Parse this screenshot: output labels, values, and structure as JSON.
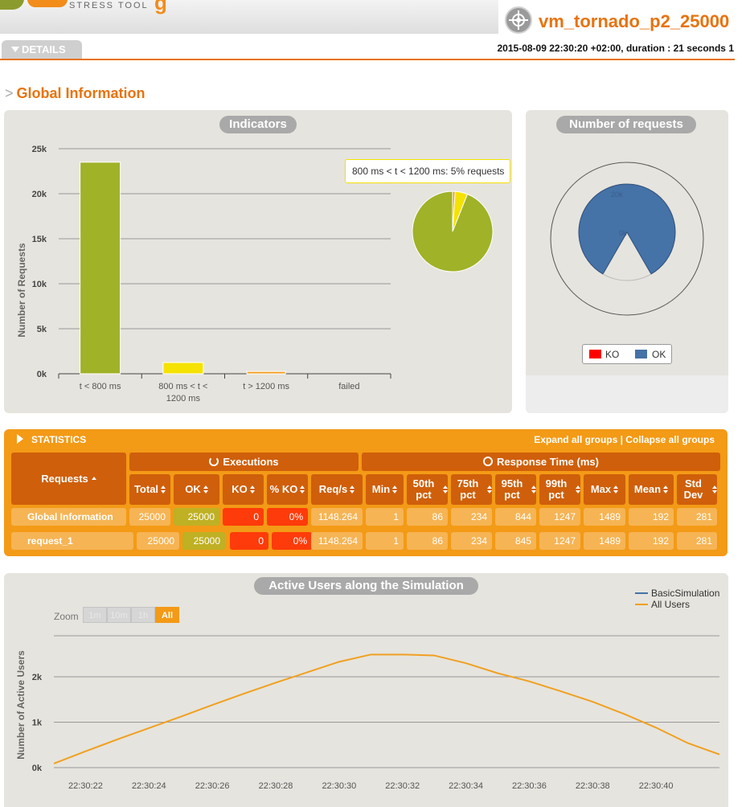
{
  "header": {
    "tagline": "STRESS TOOL",
    "simulation_name": "vm_tornado_p2_25000",
    "details_label": "DETAILS",
    "run_info": "2015-08-09 22:30:20 +02:00, duration : 21 seconds 1"
  },
  "section": {
    "prefix": ">",
    "title": "Global Information"
  },
  "indicators": {
    "title": "Indicators",
    "tooltip": "800 ms < t < 1200 ms: 5% requests",
    "chart_data": {
      "type": "bar",
      "title": "Indicators",
      "ylabel": "Number of Requests",
      "ylim": [
        0,
        25000
      ],
      "yticks": [
        "0k",
        "5k",
        "10k",
        "15k",
        "20k",
        "25k"
      ],
      "categories": [
        "t < 800 ms",
        "800 ms < t < 1200 ms",
        "t > 1200 ms",
        "failed"
      ],
      "values": [
        23500,
        1250,
        250,
        0
      ],
      "colors": [
        "#a0b228",
        "#f5e200",
        "#f39a16",
        "#fe3b0a"
      ]
    },
    "pie_data": {
      "type": "pie",
      "values": [
        94,
        5,
        1
      ],
      "colors": [
        "#a0b228",
        "#f5e200",
        "#f39a16"
      ]
    }
  },
  "requests": {
    "title": "Number of requests",
    "chart_data": {
      "type": "pie",
      "series": [
        {
          "name": "KO",
          "value": 0
        },
        {
          "name": "OK",
          "value": 25000
        }
      ],
      "ticks": [
        "0k",
        "20k"
      ],
      "colors": {
        "KO": "#ff0000",
        "OK": "#4572a7"
      }
    },
    "legend": [
      {
        "name": "KO",
        "color": "#ff0000"
      },
      {
        "name": "OK",
        "color": "#4572a7"
      }
    ]
  },
  "statistics": {
    "title": "STATISTICS",
    "links": "Expand all groups | Collapse all groups",
    "requests_header": "Requests",
    "executions_header": "Executions",
    "response_header": "Response Time (ms)",
    "columns": [
      "Total",
      "OK",
      "KO",
      "% KO",
      "Req/s",
      "Min",
      "50th pct",
      "75th pct",
      "95th pct",
      "99th pct",
      "Max",
      "Mean",
      "Std Dev"
    ],
    "rows": [
      {
        "name": "Global Information",
        "values": [
          "25000",
          "25000",
          "0",
          "0%",
          "1148.264",
          "1",
          "86",
          "234",
          "844",
          "1247",
          "1489",
          "192",
          "281"
        ]
      },
      {
        "name": "request_1",
        "values": [
          "25000",
          "25000",
          "0",
          "0%",
          "1148.264",
          "1",
          "86",
          "234",
          "845",
          "1247",
          "1489",
          "192",
          "281"
        ]
      }
    ]
  },
  "active_users": {
    "title": "Active Users along the Simulation",
    "zoom_label": "Zoom",
    "zoom_buttons": [
      "1m",
      "10m",
      "1h",
      "All"
    ],
    "chart_data": {
      "type": "line",
      "title": "Active Users along the Simulation",
      "ylabel": "Number of Active Users",
      "yticks": [
        "0k",
        "1k",
        "2k"
      ],
      "ylim": [
        0,
        2800
      ],
      "x": [
        "22:30:21",
        "22:30:22",
        "22:30:23",
        "22:30:24",
        "22:30:25",
        "22:30:26",
        "22:30:27",
        "22:30:28",
        "22:30:29",
        "22:30:30",
        "22:30:31",
        "22:30:32",
        "22:30:33",
        "22:30:34",
        "22:30:35",
        "22:30:36",
        "22:30:37",
        "22:30:38",
        "22:30:39",
        "22:30:40",
        "22:30:41",
        "22:30:42"
      ],
      "xticks": [
        "22:30:22",
        "22:30:24",
        "22:30:26",
        "22:30:28",
        "22:30:30",
        "22:30:32",
        "22:30:34",
        "22:30:36",
        "22:30:38",
        "22:30:40"
      ],
      "series": [
        {
          "name": "BasicSimulation",
          "color": "#4572a7",
          "values": []
        },
        {
          "name": "All Users",
          "color": "#f0a020",
          "values": [
            90,
            360,
            620,
            870,
            1120,
            1380,
            1630,
            1870,
            2100,
            2330,
            2490,
            2490,
            2470,
            2300,
            2080,
            1900,
            1680,
            1450,
            1180,
            880,
            540,
            290
          ]
        }
      ]
    }
  }
}
